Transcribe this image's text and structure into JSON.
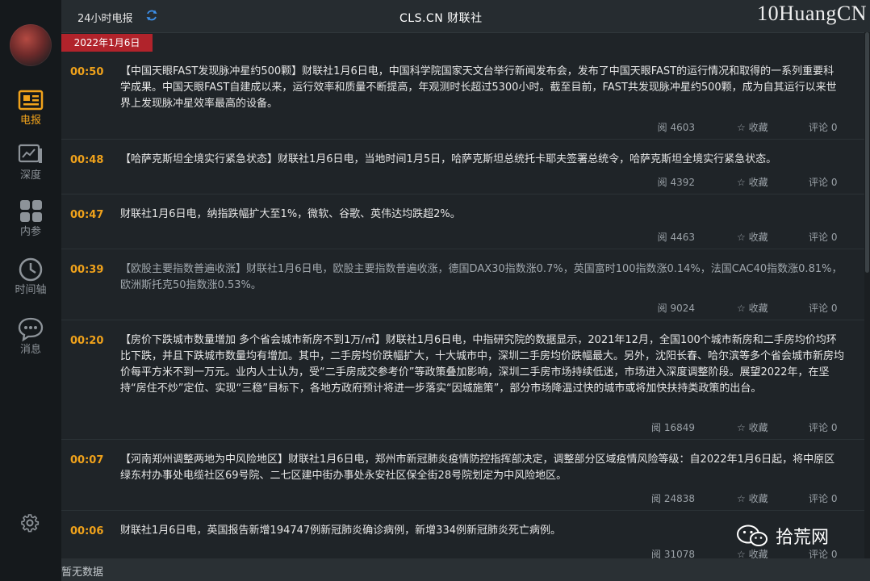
{
  "header": {
    "title": "24小时电报",
    "brand": "CLS.CN 财联社",
    "watermark": "10HuangCN"
  },
  "sidebar": {
    "items": [
      {
        "label": "电报",
        "icon": "telegram-icon",
        "active": true
      },
      {
        "label": "深度",
        "icon": "depth-chart-icon",
        "active": false
      },
      {
        "label": "内参",
        "icon": "apps-grid-icon",
        "active": false
      },
      {
        "label": "时间轴",
        "icon": "clock-icon",
        "active": false
      },
      {
        "label": "消息",
        "icon": "chat-bubble-icon",
        "active": false
      }
    ],
    "settings_icon": "gear-icon"
  },
  "date_badge": "2022年1月6日",
  "feed": [
    {
      "time": "00:50",
      "text": "【中国天眼FAST发现脉冲星约500颗】财联社1月6日电，中国科学院国家天文台举行新闻发布会，发布了中国天眼FAST的运行情况和取得的一系列重要科学成果。中国天眼FAST自建成以来，运行效率和质量不断提高，年观测时长超过5300小时。截至目前，FAST共发现脉冲星约500颗，成为自其运行以来世界上发现脉冲星效率最高的设备。",
      "reads": "阅 4603",
      "fav": "☆ 收藏",
      "comments": "评论 0"
    },
    {
      "time": "00:48",
      "text": "【哈萨克斯坦全境实行紧急状态】财联社1月6日电，当地时间1月5日，哈萨克斯坦总统托卡耶夫签署总统令，哈萨克斯坦全境实行紧急状态。",
      "reads": "阅 4392",
      "fav": "☆ 收藏",
      "comments": "评论 0"
    },
    {
      "time": "00:47",
      "text": "财联社1月6日电，纳指跌幅扩大至1%，微软、谷歌、英伟达均跌超2%。",
      "reads": "阅 4463",
      "fav": "☆ 收藏",
      "comments": "评论 0"
    },
    {
      "time": "00:39",
      "text": "【欧股主要指数普遍收涨】财联社1月6日电，欧股主要指数普遍收涨，德国DAX30指数涨0.7%，英国富时100指数涨0.14%，法国CAC40指数涨0.81%，欧洲斯托克50指数涨0.53%。",
      "reads": "阅 9024",
      "fav": "☆ 收藏",
      "comments": "评论 0"
    },
    {
      "time": "00:20",
      "text": "【房价下跌城市数量增加 多个省会城市新房不到1万/㎡】财联社1月6日电，中指研究院的数据显示，2021年12月，全国100个城市新房和二手房均价均环比下跌，并且下跌城市数量均有增加。其中，二手房均价跌幅扩大，十大城市中，深圳二手房均价跌幅最大。另外，沈阳长春、哈尔滨等多个省会城市新房均价每平方米不到一万元。业内人士认为，受“二手房成交参考价”等政策叠加影响，深圳二手房市场持续低迷，市场进入深度调整阶段。展望2022年，在坚持“房住不炒”定位、实现“三稳”目标下，各地方政府预计将进一步落实“因城施策”，部分市场降温过快的城市或将加快扶持类政策的出台。",
      "reads": "阅 16849",
      "fav": "☆ 收藏",
      "comments": "评论 0"
    },
    {
      "time": "00:07",
      "text": "【河南郑州调整两地为中风险地区】财联社1月6日电，郑州市新冠肺炎疫情防控指挥部决定，调整部分区域疫情风险等级：自2022年1月6日起，将中原区绿东村办事处电缆社区69号院、二七区建中街办事处永安社区保全街28号院划定为中风险地区。",
      "reads": "阅 24838",
      "fav": "☆ 收藏",
      "comments": "评论 0"
    },
    {
      "time": "00:06",
      "text": "财联社1月6日电，英国报告新增194747例新冠肺炎确诊病例，新增334例新冠肺炎死亡病例。",
      "reads": "阅 31078",
      "fav": "☆ 收藏",
      "comments": "评论 0"
    }
  ],
  "footer": {
    "status": "暂无数据"
  },
  "overlay_watermark": "拾荒网",
  "colors": {
    "accent": "#f0a21b",
    "date_badge": "#b1232b",
    "background": "#1f2428"
  }
}
